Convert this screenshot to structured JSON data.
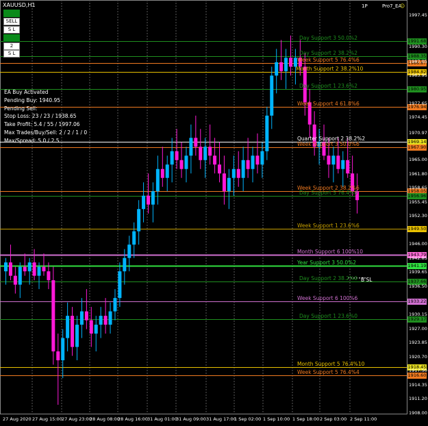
{
  "window": {
    "title": "XAUUSD,H1"
  },
  "top_right": {
    "trades_label": "1P",
    "ea_label": "Pro7_EA"
  },
  "toolbar": [
    {
      "label": "BUY",
      "style": "green"
    },
    {
      "label": "SELL",
      "style": "white"
    },
    {
      "label": "S L",
      "style": "white"
    },
    {
      "label": "B L",
      "style": "green"
    },
    {
      "label": "2",
      "style": "white"
    },
    {
      "label": "S L",
      "style": "white"
    }
  ],
  "info_panel": [
    "EA Buy Activated",
    "Pending Buy: 1940.95",
    "Pending Sell:",
    "Stop Loss: 23 / 23 / 1938.65",
    "Take Profit: 5.4 / 55 / 1997.06",
    "Max Trades/Buy/Sell: 2 / 2 / 1 / 0",
    "Max/Spread: 5.0 / 2.5"
  ],
  "levels": [
    {
      "label": "Day Support 3 50.0%2",
      "price": "1991.68",
      "color": "#1f8f1f",
      "tag": "#1f8f1f"
    },
    {
      "label": "Day Support 2 38.2%2",
      "price": "1988.35",
      "color": "#1f8f1f",
      "tag": "#1f8f1f"
    },
    {
      "label": "Week Support 5 76.4%6",
      "price": "1986.87",
      "color": "#f07a20",
      "tag": "#f07a20"
    },
    {
      "label": "Month Support 2 38.2%10",
      "price": "1984.82",
      "color": "#e8c000",
      "tag": "#e8c000"
    },
    {
      "label": "Day Support 1 23.6%2",
      "price": "1980.95",
      "color": "#1f8f1f",
      "tag": "#1f8f1f"
    },
    {
      "label": "Week Support 4 61.8%6",
      "price": "1976.94",
      "color": "#f07a20",
      "tag": "#f07a20"
    },
    {
      "label": "Quarter Support 2 38.2%2",
      "price": "1969.14",
      "color": "#ffffff",
      "tag": "#e8e020"
    },
    {
      "label": "Week Support 3 50.0%6",
      "price": "1967.90",
      "color": "#f07a20",
      "tag": "#f07a20"
    },
    {
      "label": "Week Support 2 38.2%6",
      "price": "1958.05",
      "color": "#f07a20",
      "tag": "#f07a20"
    },
    {
      "label": "Day Support 5 76.4%0",
      "price": "1956.96",
      "color": "#1f8f1f",
      "tag": "#1f8f1f"
    },
    {
      "label": "Week Support 1 23.6%6",
      "price": "1949.50",
      "color": "#c8a000",
      "tag": "#e8c000"
    },
    {
      "label": "Month Support 6 100%10",
      "price": "1943.79",
      "color": "#d070d0",
      "tag": "#ff6ad8"
    },
    {
      "label": "Year Support 3 50.0%2",
      "price": "1941.19",
      "color": "#30e040",
      "tag": "#30e040"
    },
    {
      "label": "Day Support 2 38.2%0",
      "price": "1937.66",
      "color": "#1f8f1f",
      "tag": "#1f8f1f"
    },
    {
      "label": "Week Support 6 100%6",
      "price": "1933.22",
      "color": "#d070d0",
      "tag": "#d070d0"
    },
    {
      "label": "Day Support 1 23.6%0",
      "price": "1929.17",
      "color": "#1f8f1f",
      "tag": "#1f8f1f"
    },
    {
      "label": "Month Support 5 76.4%10",
      "price": "1918.45",
      "color": "#e8c000",
      "tag": "#e8e020"
    },
    {
      "label": "Week Support 5 76.4%4",
      "price": "1916.60",
      "color": "#f07a20",
      "tag": "#f07a20"
    }
  ],
  "price_axis": [
    "1997.45",
    "1990.30",
    "1987.05",
    "1983.95",
    "1977.65",
    "1974.45",
    "1970.97",
    "1965.00",
    "1961.80",
    "1958.65",
    "1955.45",
    "1952.30",
    "1946.00",
    "1942.85",
    "1939.65",
    "1936.50",
    "1930.15",
    "1927.00",
    "1923.85",
    "1920.70",
    "1917.50",
    "1914.35",
    "1911.20",
    "1908.00"
  ],
  "time_axis": [
    "27 Aug 2020",
    "27 Aug 15:00",
    "27 Aug 23:00",
    "28 Aug 08:00",
    "28 Aug 16:00",
    "31 Aug 01:00",
    "31 Aug 09:00",
    "31 Aug 17:00",
    "1 Sep 02:00",
    "1 Sep 10:00",
    "1 Sep 18:00",
    "2 Sep 03:00",
    "2 Sep 11:00"
  ],
  "bsl_marker": "B SL",
  "colors": {
    "bull": "#00b4ff",
    "bear": "#ff19d8",
    "grid": "#5a5a5a",
    "background": "#000000"
  },
  "chart_data": {
    "type": "candlestick",
    "symbol": "XAUUSD",
    "timeframe": "H1",
    "ylim": [
      1908.0,
      1997.45
    ],
    "note_candles": [
      [
        1940,
        1943,
        1937,
        1942
      ],
      [
        1942,
        1946,
        1938,
        1939
      ],
      [
        1939,
        1941,
        1935,
        1937
      ],
      [
        1937,
        1942,
        1934,
        1941
      ],
      [
        1941,
        1944,
        1939,
        1940
      ],
      [
        1940,
        1943,
        1937,
        1942
      ],
      [
        1942,
        1945,
        1938,
        1939
      ],
      [
        1939,
        1942,
        1936,
        1941
      ],
      [
        1941,
        1944,
        1939,
        1940
      ],
      [
        1940,
        1942,
        1936,
        1938
      ],
      [
        1938,
        1941,
        1919,
        1922
      ],
      [
        1922,
        1926,
        1910,
        1920
      ],
      [
        1920,
        1927,
        1916,
        1925
      ],
      [
        1925,
        1933,
        1922,
        1930
      ],
      [
        1930,
        1932,
        1921,
        1923
      ],
      [
        1923,
        1930,
        1920,
        1928
      ],
      [
        1928,
        1934,
        1925,
        1931
      ],
      [
        1931,
        1936,
        1927,
        1929
      ],
      [
        1929,
        1932,
        1923,
        1926
      ],
      [
        1926,
        1930,
        1922,
        1928
      ],
      [
        1928,
        1932,
        1925,
        1930
      ],
      [
        1930,
        1934,
        1926,
        1928
      ],
      [
        1928,
        1933,
        1926,
        1931
      ],
      [
        1931,
        1936,
        1929,
        1934
      ],
      [
        1934,
        1942,
        1932,
        1940
      ],
      [
        1940,
        1945,
        1937,
        1943
      ],
      [
        1943,
        1948,
        1940,
        1946
      ],
      [
        1946,
        1951,
        1943,
        1949
      ],
      [
        1949,
        1956,
        1946,
        1954
      ],
      [
        1954,
        1960,
        1951,
        1957
      ],
      [
        1957,
        1962,
        1953,
        1955
      ],
      [
        1955,
        1960,
        1951,
        1958
      ],
      [
        1958,
        1966,
        1955,
        1963
      ],
      [
        1963,
        1968,
        1959,
        1961
      ],
      [
        1961,
        1966,
        1958,
        1964
      ],
      [
        1964,
        1970,
        1960,
        1967
      ],
      [
        1967,
        1972,
        1963,
        1965
      ],
      [
        1965,
        1969,
        1961,
        1963
      ],
      [
        1963,
        1968,
        1960,
        1966
      ],
      [
        1966,
        1973,
        1962,
        1970
      ],
      [
        1970,
        1975,
        1966,
        1968
      ],
      [
        1968,
        1972,
        1963,
        1965
      ],
      [
        1965,
        1970,
        1961,
        1968
      ],
      [
        1968,
        1973,
        1964,
        1966
      ],
      [
        1966,
        1970,
        1962,
        1964
      ],
      [
        1964,
        1969,
        1960,
        1962
      ],
      [
        1962,
        1966,
        1955,
        1958
      ],
      [
        1958,
        1963,
        1954,
        1961
      ],
      [
        1961,
        1966,
        1957,
        1963
      ],
      [
        1963,
        1967,
        1959,
        1961
      ],
      [
        1961,
        1968,
        1958,
        1965
      ],
      [
        1965,
        1970,
        1961,
        1963
      ],
      [
        1963,
        1968,
        1960,
        1966
      ],
      [
        1966,
        1971,
        1962,
        1964
      ],
      [
        1964,
        1969,
        1961,
        1967
      ],
      [
        1967,
        1977,
        1965,
        1975
      ],
      [
        1975,
        1986,
        1972,
        1984
      ],
      [
        1984,
        1990,
        1980,
        1987
      ],
      [
        1987,
        1992,
        1983,
        1985
      ],
      [
        1985,
        1990,
        1981,
        1988
      ],
      [
        1988,
        1993,
        1984,
        1986
      ],
      [
        1986,
        1990,
        1982,
        1988
      ],
      [
        1988,
        1992,
        1984,
        1986
      ],
      [
        1986,
        1989,
        1975,
        1978
      ],
      [
        1978,
        1981,
        1970,
        1973
      ],
      [
        1973,
        1976,
        1966,
        1968
      ],
      [
        1968,
        1972,
        1964,
        1969
      ],
      [
        1969,
        1973,
        1965,
        1966
      ],
      [
        1966,
        1970,
        1961,
        1964
      ],
      [
        1964,
        1968,
        1960,
        1966
      ],
      [
        1966,
        1970,
        1962,
        1963
      ],
      [
        1963,
        1967,
        1959,
        1965
      ],
      [
        1965,
        1970,
        1961,
        1962
      ],
      [
        1962,
        1966,
        1957,
        1958
      ],
      [
        1958,
        1962,
        1953,
        1956
      ]
    ]
  }
}
